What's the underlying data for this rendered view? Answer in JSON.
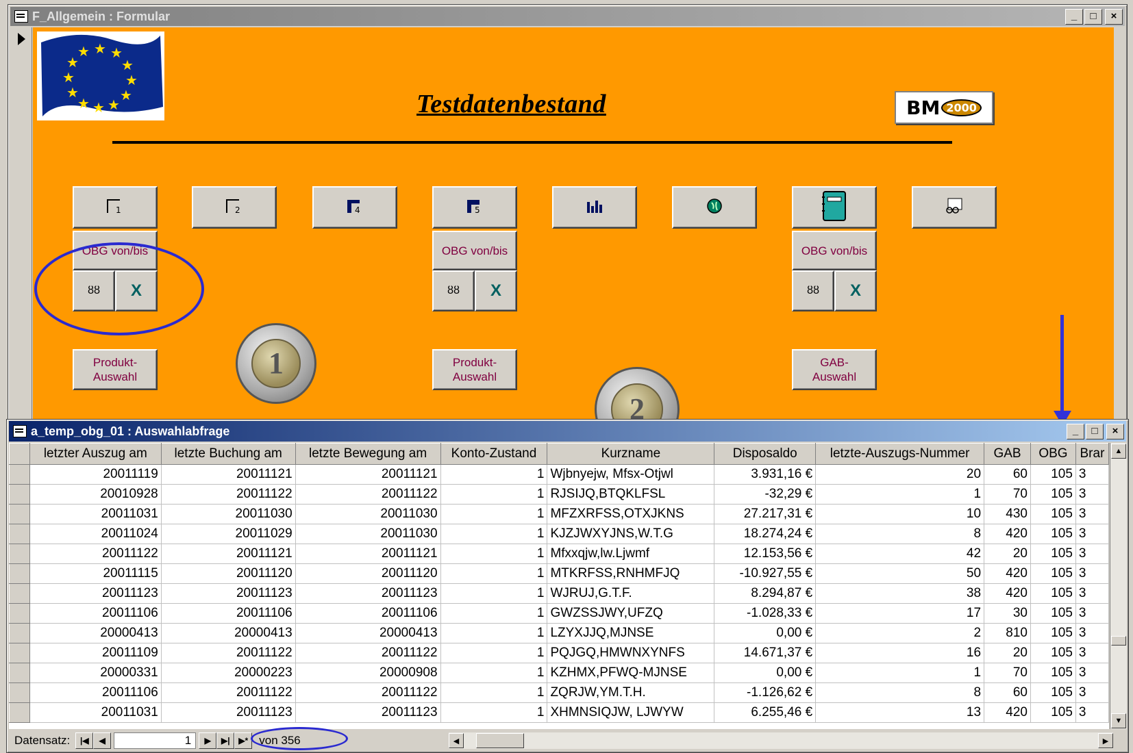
{
  "form_window": {
    "title": "F_Allgemein : Formular",
    "heading": "Testdatenbestand",
    "logo_text": "BM",
    "logo_year": "2000",
    "buttons_top": [
      {
        "name": "report-1",
        "num": "1"
      },
      {
        "name": "report-2",
        "num": "2"
      },
      {
        "name": "report-4",
        "num": "4"
      },
      {
        "name": "report-5",
        "num": "5"
      },
      {
        "name": "chart",
        "num": ""
      },
      {
        "name": "globe",
        "num": ""
      },
      {
        "name": "notebook",
        "num": ""
      },
      {
        "name": "glasses-form",
        "num": ""
      }
    ],
    "obg_label": "OBG von/bis",
    "produkt_label_1": "Produkt-",
    "produkt_label_2": "Auswahl",
    "gab_label_1": "GAB-",
    "gab_label_2": "Auswahl",
    "coin_1": "1",
    "coin_2": "2"
  },
  "query_window": {
    "title": "a_temp_obg_01 : Auswahlabfrage",
    "columns": [
      "letzter Auszug am",
      "letzte Buchung am",
      "letzte Bewegung am",
      "Konto-Zustand",
      "Kurzname",
      "Disposaldo",
      "letzte-Auszugs-Nummer",
      "GAB",
      "OBG",
      "Brar"
    ],
    "rows": [
      [
        "20011119",
        "20011121",
        "20011121",
        "1",
        "Wjbnyejw, Mfsx-Otjwl",
        "3.931,16 €",
        "20",
        "60",
        "105",
        "3"
      ],
      [
        "20010928",
        "20011122",
        "20011122",
        "1",
        "RJSIJQ,BTQKLFSL",
        "-32,29 €",
        "1",
        "70",
        "105",
        "3"
      ],
      [
        "20011031",
        "20011030",
        "20011030",
        "1",
        "MFZXRFSS,OTXJKNS",
        "27.217,31 €",
        "10",
        "430",
        "105",
        "3"
      ],
      [
        "20011024",
        "20011029",
        "20011030",
        "1",
        "KJZJWXYJNS,W.T.G",
        "18.274,24 €",
        "8",
        "420",
        "105",
        "3"
      ],
      [
        "20011122",
        "20011121",
        "20011121",
        "1",
        "Mfxxqjw,lw.Ljwmf",
        "12.153,56 €",
        "42",
        "20",
        "105",
        "3"
      ],
      [
        "20011115",
        "20011120",
        "20011120",
        "1",
        "MTKRFSS,RNHMFJQ",
        "-10.927,55 €",
        "50",
        "420",
        "105",
        "3"
      ],
      [
        "20011123",
        "20011123",
        "20011123",
        "1",
        "WJRUJ,G.T.F.",
        "8.294,87 €",
        "38",
        "420",
        "105",
        "3"
      ],
      [
        "20011106",
        "20011106",
        "20011106",
        "1",
        "GWZSSJWY,UFZQ",
        "-1.028,33 €",
        "17",
        "30",
        "105",
        "3"
      ],
      [
        "20000413",
        "20000413",
        "20000413",
        "1",
        "LZYXJJQ,MJNSE",
        "0,00 €",
        "2",
        "810",
        "105",
        "3"
      ],
      [
        "20011109",
        "20011122",
        "20011122",
        "1",
        "PQJGQ,HMWNXYNFS",
        "14.671,37 €",
        "16",
        "20",
        "105",
        "3"
      ],
      [
        "20000331",
        "20000223",
        "20000908",
        "1",
        "KZHMX,PFWQ-MJNSE",
        "0,00 €",
        "1",
        "70",
        "105",
        "3"
      ],
      [
        "20011106",
        "20011122",
        "20011122",
        "1",
        "ZQRJW,YM.T.H.",
        "-1.126,62 €",
        "8",
        "60",
        "105",
        "3"
      ],
      [
        "20011031",
        "20011123",
        "20011123",
        "1",
        "XHMNSIQJW, LJWYW",
        "6.255,46 €",
        "13",
        "420",
        "105",
        "3"
      ]
    ],
    "nav_label": "Datensatz:",
    "record_current": "1",
    "record_total_text": "von 356"
  }
}
